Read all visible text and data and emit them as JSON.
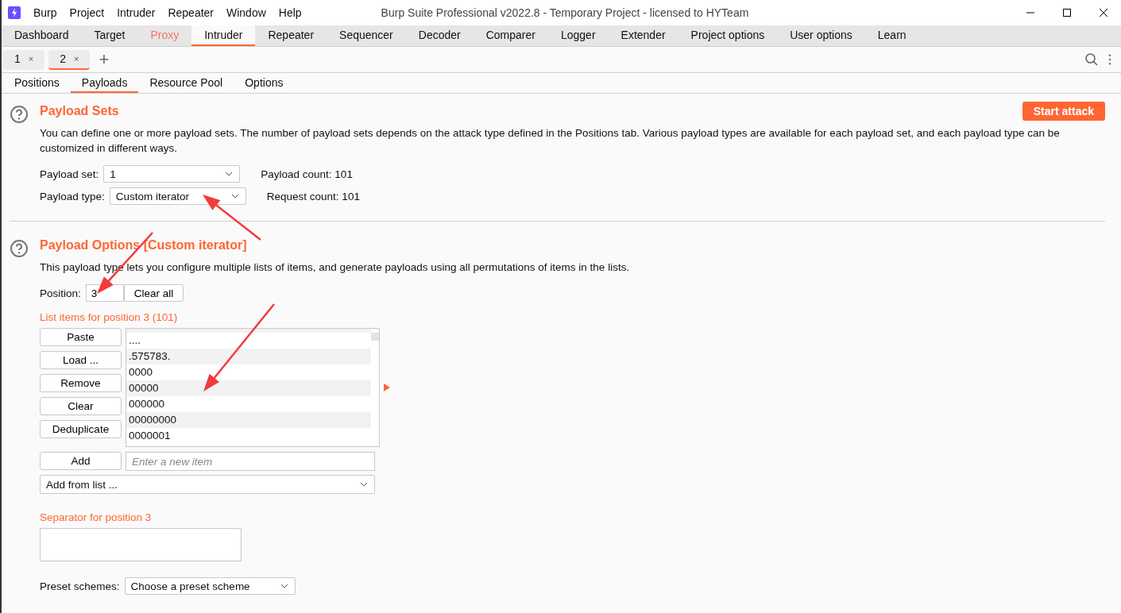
{
  "window": {
    "title": "Burp Suite Professional v2022.8 - Temporary Project - licensed to HYTeam"
  },
  "menu": [
    "Burp",
    "Project",
    "Intruder",
    "Repeater",
    "Window",
    "Help"
  ],
  "main_tabs": [
    {
      "label": "Dashboard",
      "selected": false,
      "highlighted": false
    },
    {
      "label": "Target",
      "selected": false,
      "highlighted": false
    },
    {
      "label": "Proxy",
      "selected": false,
      "highlighted": true
    },
    {
      "label": "Intruder",
      "selected": true,
      "highlighted": false
    },
    {
      "label": "Repeater",
      "selected": false,
      "highlighted": false
    },
    {
      "label": "Sequencer",
      "selected": false,
      "highlighted": false
    },
    {
      "label": "Decoder",
      "selected": false,
      "highlighted": false
    },
    {
      "label": "Comparer",
      "selected": false,
      "highlighted": false
    },
    {
      "label": "Logger",
      "selected": false,
      "highlighted": false
    },
    {
      "label": "Extender",
      "selected": false,
      "highlighted": false
    },
    {
      "label": "Project options",
      "selected": false,
      "highlighted": false
    },
    {
      "label": "User options",
      "selected": false,
      "highlighted": false
    },
    {
      "label": "Learn",
      "selected": false,
      "highlighted": false
    }
  ],
  "attack_tabs": [
    {
      "label": "1",
      "close": "×",
      "selected": false
    },
    {
      "label": "2",
      "close": "×",
      "selected": true
    }
  ],
  "new_tab": "+",
  "sub_tabs": [
    {
      "label": "Positions",
      "selected": false
    },
    {
      "label": "Payloads",
      "selected": true
    },
    {
      "label": "Resource Pool",
      "selected": false
    },
    {
      "label": "Options",
      "selected": false
    }
  ],
  "payload_sets": {
    "title": "Payload Sets",
    "start_button": "Start attack",
    "description": "You can define one or more payload sets. The number of payload sets depends on the attack type defined in the Positions tab. Various payload types are available for each payload set, and each payload type can be customized in different ways.",
    "set_label": "Payload set:",
    "set_value": "1",
    "payload_count": "Payload count: 101",
    "type_label": "Payload type:",
    "type_value": "Custom iterator",
    "request_count": "Request count: 101"
  },
  "payload_options": {
    "title": "Payload Options [Custom iterator]",
    "description": "This payload type lets you configure multiple lists of items, and generate payloads using all permutations of items in the lists.",
    "position_label": "Position:",
    "position_value": "3",
    "clear_all": "Clear all",
    "list_title": "List items for position 3 (101)",
    "list_buttons": [
      "Paste",
      "Load ...",
      "Remove",
      "Clear",
      "Deduplicate"
    ],
    "list_items": [
      "....",
      ".575783.",
      "0000",
      "00000",
      "000000",
      "00000000",
      "0000001"
    ],
    "add_button": "Add",
    "add_placeholder": "Enter a new item",
    "add_from_list": "Add from list ...",
    "separator_title": "Separator for position 3",
    "preset_label": "Preset schemes:",
    "preset_value": "Choose a preset scheme"
  }
}
